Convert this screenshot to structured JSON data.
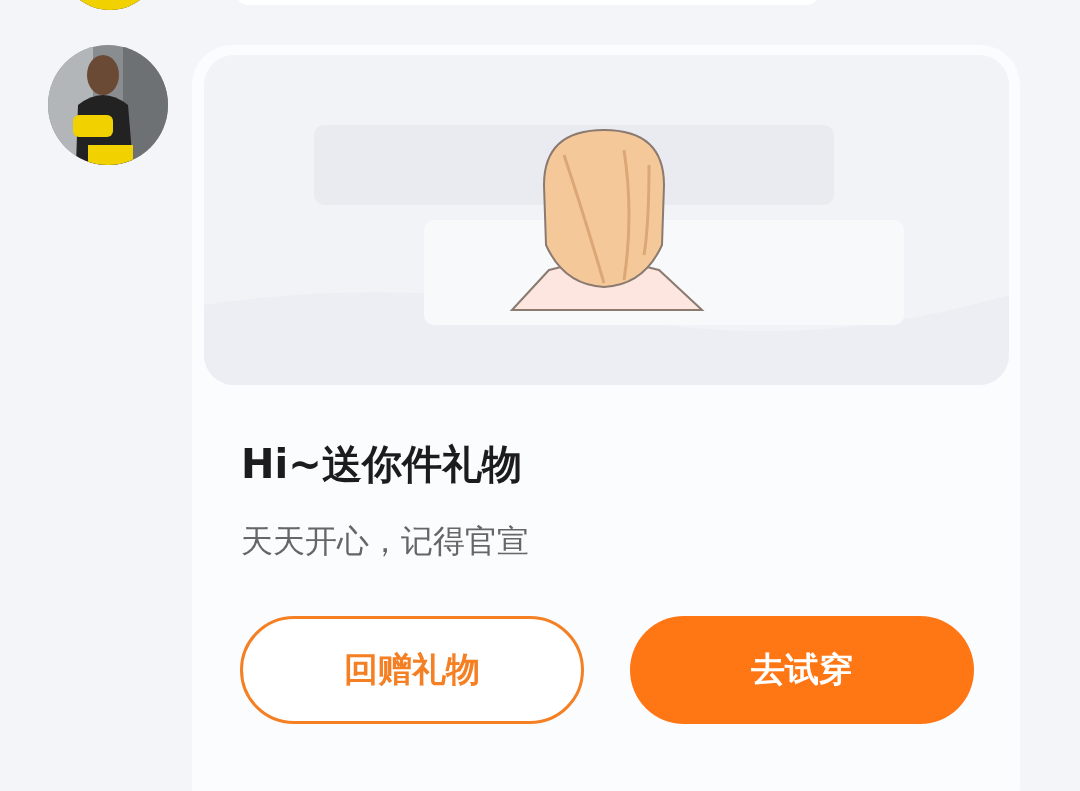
{
  "gift_card": {
    "title": "Hi~送你件礼物",
    "message": "天天开心，记得官宣",
    "buttons": [
      {
        "label": "回赠礼物",
        "kind": "outline"
      },
      {
        "label": "去试穿",
        "kind": "filled"
      }
    ]
  }
}
